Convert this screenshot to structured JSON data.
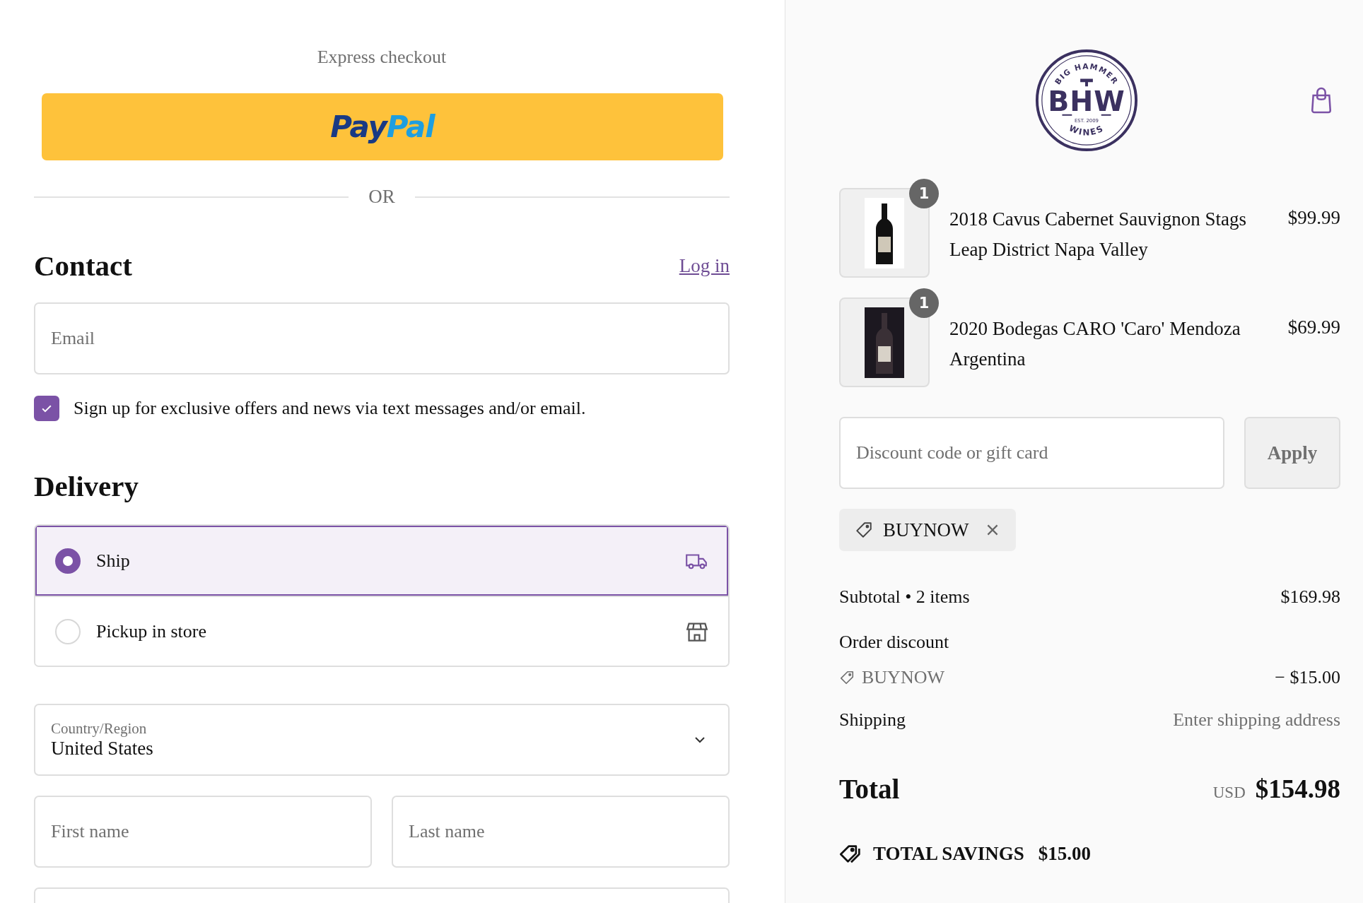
{
  "express_checkout": {
    "title": "Express checkout",
    "paypal": {
      "pay": "Pay",
      "pal": "Pal"
    }
  },
  "divider_label": "OR",
  "contact": {
    "heading": "Contact",
    "login_link": "Log in",
    "email": {
      "placeholder": "Email"
    },
    "offers": {
      "label": "Sign up for exclusive offers and news via text messages and/or email.",
      "checked": true
    }
  },
  "delivery": {
    "heading": "Delivery",
    "options": [
      {
        "label": "Ship",
        "kind": "ship",
        "selected": true
      },
      {
        "label": "Pickup in store",
        "kind": "pickup",
        "selected": false
      }
    ]
  },
  "country": {
    "label": "Country/Region",
    "value": "United States"
  },
  "first_name": {
    "placeholder": "First name"
  },
  "last_name": {
    "placeholder": "Last name"
  },
  "logo": {
    "top": "BIG HAMMER",
    "monogram": "BHW",
    "est": "EST. 2009",
    "bottom": "WINES"
  },
  "items": [
    {
      "quantity": "1",
      "name": "2018 Cavus Cabernet Sauvignon Stags Leap District Napa Valley",
      "price": "$99.99",
      "kind": "light"
    },
    {
      "quantity": "1",
      "name": "2020 Bodegas CARO 'Caro' Mendoza Argentina",
      "price": "$69.99",
      "kind": "dark"
    }
  ],
  "discount": {
    "placeholder": "Discount code or gift card",
    "apply": "Apply"
  },
  "applied_codes": [
    {
      "code": "BUYNOW"
    }
  ],
  "subtotal": {
    "label": "Subtotal • 2 items",
    "value": "$169.98"
  },
  "order_discount": {
    "label": "Order discount",
    "code": "BUYNOW",
    "amount": "− $15.00"
  },
  "shipping": {
    "label": "Shipping",
    "value": "Enter shipping address"
  },
  "total": {
    "label": "Total",
    "currency": "USD",
    "amount": "$154.98"
  },
  "savings": {
    "label": "TOTAL SAVINGS",
    "amount": "$15.00"
  }
}
